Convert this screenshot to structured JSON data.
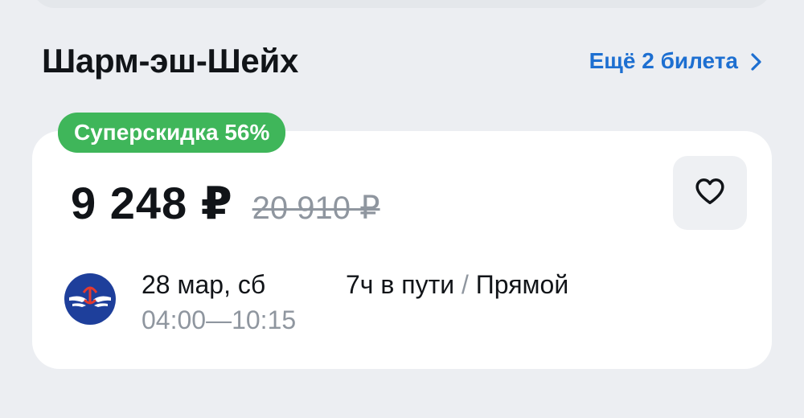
{
  "header": {
    "title": "Шарм-эш-Шейх",
    "more_link": "Ещё 2 билета"
  },
  "ticket": {
    "badge": "Суперскидка 56%",
    "price_current": "9 248 ₽",
    "price_old": "20 910 ₽",
    "date": "28 мар, сб",
    "time_depart": "04:00",
    "time_dash": "—",
    "time_arrive": "10:15",
    "duration": "7ч в пути",
    "separator": "/",
    "route_type": "Прямой"
  },
  "icons": {
    "chevron": "chevron-right-icon",
    "favorite": "heart-icon",
    "airline": "airline-logo-icon"
  },
  "colors": {
    "accent": "#1d6fd1",
    "discount_badge": "#3fb65a",
    "airline_logo": "#1e3f9b",
    "muted_text": "#8f969f"
  }
}
